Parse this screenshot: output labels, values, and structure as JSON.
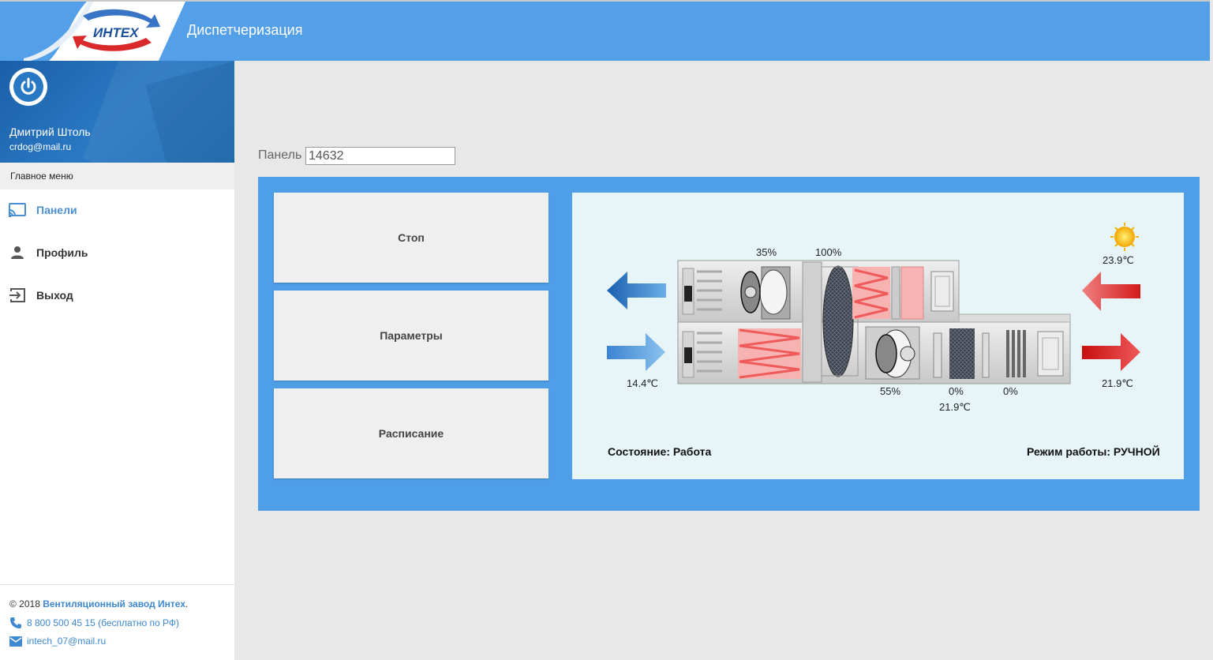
{
  "header": {
    "logo_text": "ИНТЕХ",
    "title": "Диспетчеризация"
  },
  "user": {
    "name": "Дмитрий Штоль",
    "email": "crdog@mail.ru"
  },
  "menu": {
    "header": "Главное меню",
    "items": [
      {
        "label": "Панели",
        "icon": "cast-icon",
        "active": true
      },
      {
        "label": "Профиль",
        "icon": "person-icon",
        "active": false
      },
      {
        "label": "Выход",
        "icon": "exit-icon",
        "active": false
      }
    ]
  },
  "footer": {
    "copyright_prefix": "© 2018",
    "company_link": "Вентиляционный завод Интех",
    "period": ".",
    "phone": "8 800 500 45 15 (бесплатно по РФ)",
    "email": "intech_07@mail.ru"
  },
  "panel": {
    "label": "Панель",
    "value": "14632"
  },
  "controls": {
    "stop": "Стоп",
    "params": "Параметры",
    "schedule": "Расписание"
  },
  "scheme": {
    "damper_exhaust_pct": "35%",
    "recuperator_pct": "100%",
    "supply_fan_pct": "55%",
    "heater_pct": "0%",
    "cooler_pct": "0%",
    "outdoor_temp": "23.9℃",
    "exhaust_in_temp": "14.4℃",
    "supply_temp": "21.9℃",
    "after_heater_temp": "21.9℃",
    "status": "Состояние: Работа",
    "mode": "Режим работы: РУЧНОЙ"
  },
  "colors": {
    "header_bg": "#53a0e8",
    "panel_bg": "#4f9ee8",
    "scheme_bg": "#e7f5f8",
    "accent": "#4a8fd4"
  }
}
